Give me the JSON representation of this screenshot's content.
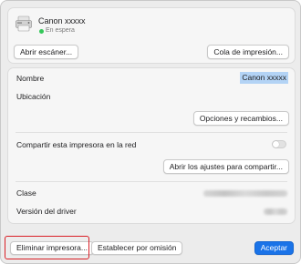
{
  "printer": {
    "name": "Canon xxxxx",
    "status": "En espera",
    "status_color": "#34c759"
  },
  "top_buttons": {
    "open_scanner": "Abrir escáner...",
    "print_queue": "Cola de impresión..."
  },
  "details": {
    "name_label": "Nombre",
    "name_value": "Canon xxxxx",
    "location_label": "Ubicación",
    "options_button": "Opciones y recambios..."
  },
  "sharing": {
    "share_label": "Compartir esta impresora en la red",
    "share_enabled": false,
    "open_settings_button": "Abrir los ajustes para compartir..."
  },
  "info": {
    "class_label": "Clase",
    "driver_label": "Versión del driver"
  },
  "footer": {
    "delete_button": "Eliminar impresora...",
    "default_button": "Establecer por omisión",
    "accept_button": "Aceptar",
    "accent_color": "#1a73e8",
    "highlight_color": "#d91f26"
  }
}
